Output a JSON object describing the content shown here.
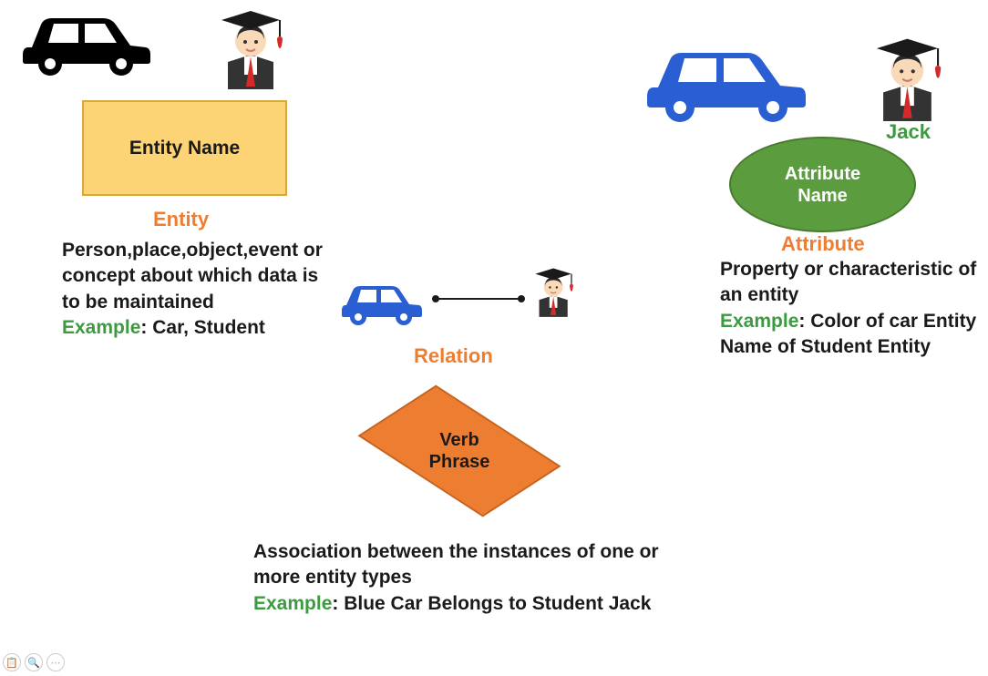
{
  "entity": {
    "box_label": "Entity Name",
    "title": "Entity",
    "description": "Person,place,object,event or concept about which data is to be maintained",
    "example_label": "Example",
    "example_text": ": Car, Student"
  },
  "relation": {
    "title": "Relation",
    "box_label_l1": "Verb",
    "box_label_l2": "Phrase",
    "description": "Association between the instances of one or more entity types",
    "example_label": "Example",
    "example_text": ": Blue Car Belongs to Student Jack"
  },
  "attribute": {
    "student_name": "Jack",
    "box_label_l1": "Attribute",
    "box_label_l2": "Name",
    "title": "Attribute",
    "description": "Property or characteristic of an entity",
    "example_label": "Example",
    "example_text": ": Color of car Entity Name of Student Entity"
  },
  "icons": {
    "car_black": "car-icon",
    "car_blue": "car-icon",
    "car_blue_small": "car-icon",
    "student": "student-icon",
    "student_small": "student-icon"
  }
}
